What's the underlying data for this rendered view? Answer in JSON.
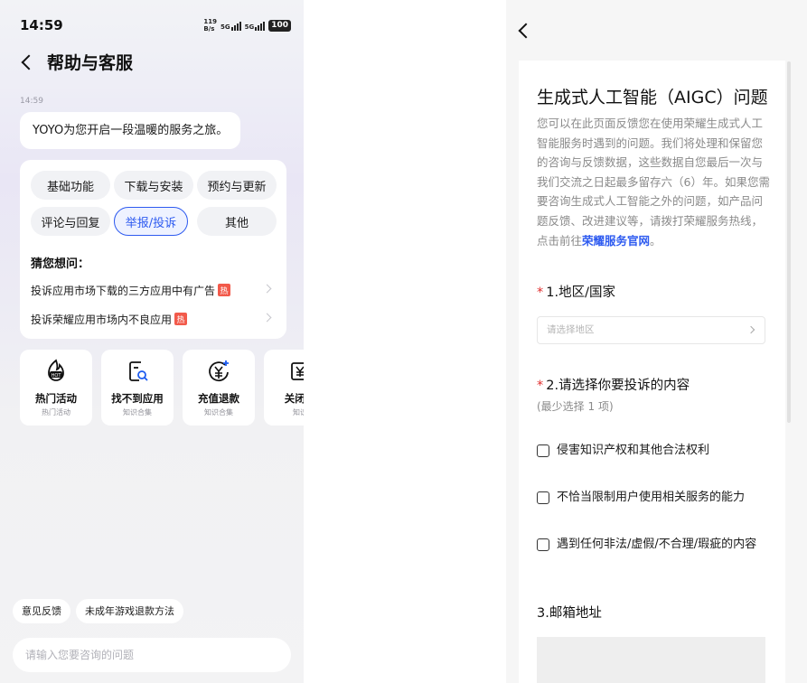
{
  "left": {
    "status": {
      "time": "14:59",
      "net_speed_top": "119",
      "net_speed_bottom": "B/s",
      "sig1": "5G",
      "sig2": "5G",
      "battery": "100"
    },
    "nav": {
      "title": "帮助与客服"
    },
    "chat": {
      "timestamp": "14:59",
      "greeting": "YOYO为您开启一段温暖的服务之旅。"
    },
    "categories": [
      "基础功能",
      "下载与安装",
      "预约与更新",
      "评论与回复",
      "举报/投诉",
      "其他"
    ],
    "selected_category": "举报/投诉",
    "guess_title": "猜您想问：",
    "questions": [
      {
        "text": "投诉应用市场下载的三方应用中有广告",
        "badge": "热"
      },
      {
        "text": "投诉荣耀应用市场内不良应用",
        "badge": "热"
      }
    ],
    "tiles": [
      {
        "title": "热门活动",
        "sub": "热门活动",
        "icon": "hot-icon"
      },
      {
        "title": "找不到应用",
        "sub": "知识合集",
        "icon": "search-app-icon"
      },
      {
        "title": "充值退款",
        "sub": "知识合集",
        "icon": "refund-icon"
      },
      {
        "title": "关闭自",
        "sub": "知识",
        "icon": "close-auto-icon"
      }
    ],
    "quick_buttons": [
      "意见反馈",
      "未成年游戏退款方法"
    ],
    "input_placeholder": "请输入您要咨询的问题"
  },
  "right": {
    "title": "生成式人工智能（AIGC）问题",
    "description": "您可以在此页面反馈您在使用荣耀生成式人工智能服务时遇到的问题。我们将处理和保留您的咨询与反馈数据，这些数据自您最后一次与我们交流之日起最多留存六（6）年。如果您需要咨询生成式人工智能之外的问题，如产品问题反馈、改进建议等，请拨打荣耀服务热线，点击前往",
    "description_link": "荣耀服务官网",
    "description_end": "。",
    "q1": {
      "label": "1.地区/国家",
      "required_mark": "*",
      "placeholder": "请选择地区"
    },
    "q2": {
      "label": "2.请选择你要投诉的内容",
      "required_mark": "*",
      "hint": "(最少选择 1 项)"
    },
    "options": [
      "侵害知识产权和其他合法权利",
      "不恰当限制用户使用相关服务的能力",
      "遇到任何非法/虚假/不合理/瑕疵的内容"
    ],
    "q3": {
      "label": "3.邮箱地址"
    }
  }
}
